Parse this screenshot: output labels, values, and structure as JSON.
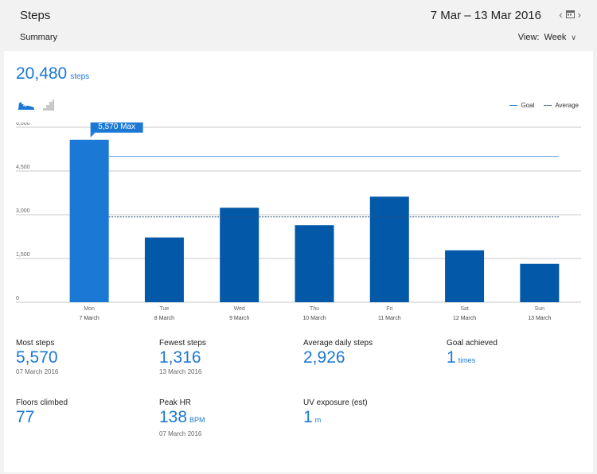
{
  "header": {
    "title": "Steps",
    "date_range": "7 Mar – 13 Mar 2016",
    "prev_icon": "chevron-left-icon",
    "calendar_icon": "calendar-icon",
    "next_icon": "chevron-right-icon",
    "summary_label": "Summary",
    "view_label": "View:",
    "view_value": "Week"
  },
  "total": {
    "value": "20,480",
    "unit": "steps"
  },
  "tabs": {
    "steps_icon": "shoe-icon",
    "floors_icon": "stairs-icon"
  },
  "legend": {
    "goal": "Goal",
    "average": "Average"
  },
  "chart_data": {
    "type": "bar",
    "categories": [
      "Mon",
      "Tue",
      "Wed",
      "Thu",
      "Fri",
      "Sat",
      "Sun"
    ],
    "dates": [
      "7 March",
      "8 March",
      "9 March",
      "10 March",
      "11 March",
      "12 March",
      "13 March"
    ],
    "values": [
      5570,
      2220,
      3240,
      2640,
      3620,
      1780,
      1316
    ],
    "goal": 5000,
    "average": 2926,
    "ylim": [
      0,
      6000
    ],
    "yticks": [
      "0",
      "1,500",
      "3,000",
      "4,500",
      "6,000"
    ],
    "ytick_values": [
      0,
      1500,
      3000,
      4500,
      6000
    ],
    "max_label": "5,570 Max",
    "max_index": 0,
    "highlight_color": "#1b78d4",
    "bar_color": "#0358a8",
    "grid": true,
    "legend_position": "top-right"
  },
  "stats": {
    "most": {
      "label": "Most steps",
      "value": "5,570",
      "sub": "07 March 2016"
    },
    "fewest": {
      "label": "Fewest steps",
      "value": "1,316",
      "sub": "13 March 2016"
    },
    "average": {
      "label": "Average daily steps",
      "value": "2,926"
    },
    "goal": {
      "label": "Goal achieved",
      "value": "1",
      "unit": "times"
    },
    "floors": {
      "label": "Floors climbed",
      "value": "77"
    },
    "peak_hr": {
      "label": "Peak HR",
      "value": "138",
      "unit": "BPM",
      "sub": "07 March 2016"
    },
    "uv": {
      "label": "UV exposure (est)",
      "value": "1",
      "unit": "m"
    }
  }
}
